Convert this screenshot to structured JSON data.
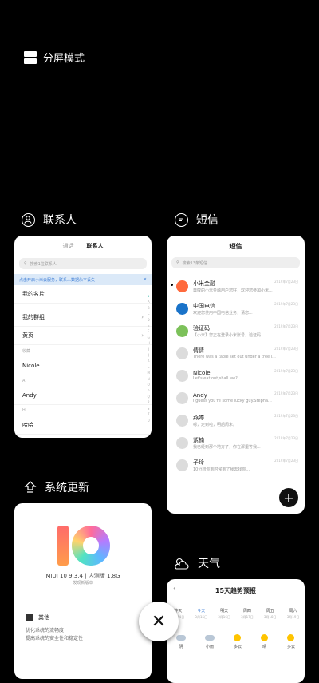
{
  "split_screen": {
    "label": "分屏模式"
  },
  "contacts": {
    "header": "联系人",
    "tabs": [
      {
        "label": "通话"
      },
      {
        "label": "联系人"
      }
    ],
    "search_placeholder": "搜索1位联系人",
    "banner": "点击开启小米云服务，联系人数据永不丢失",
    "rows": [
      {
        "label": "我的名片"
      },
      {
        "label": "我的群组"
      },
      {
        "label": "黄页"
      }
    ],
    "section_labels": [
      "收藏",
      "A",
      "H"
    ],
    "contacts_list": [
      {
        "name": "Nicole"
      },
      {
        "name": "Andy"
      },
      {
        "name": "哈哈"
      }
    ],
    "alpha_index": [
      "★",
      "A",
      "B",
      "C",
      "D",
      "E",
      "F",
      "G",
      "H",
      "I",
      "J",
      "K",
      "L",
      "M",
      "N",
      "O",
      "P",
      "Q",
      "R",
      "S",
      "T",
      "U"
    ]
  },
  "sms": {
    "header": "短信",
    "title": "短信",
    "search_placeholder": "搜索13条短信",
    "messages": [
      {
        "name": "小米金融",
        "preview": "尊敬的小米金融用户您好，欢迎您参加小米...",
        "time": "2019年7月23日",
        "avatar_color": "#ff6a3d",
        "unread": true
      },
      {
        "name": "中国电信",
        "preview": "欢迎您使用中国电信业务，请您...",
        "time": "2019年7月23日",
        "avatar_color": "#1a73c9",
        "unread": false
      },
      {
        "name": "验证码",
        "preview": "【小米】您正在登录小米账号，验证码...",
        "time": "2019年7月23日",
        "avatar_color": "#7cc15a",
        "unread": false
      },
      {
        "name": "倩倩",
        "preview": "There was a table set out under a tree i...",
        "time": "2019年7月23日",
        "avatar_color": "#dcdcdc",
        "unread": false
      },
      {
        "name": "Nicole",
        "preview": "Let's eat out,shall we?",
        "time": "2019年7月23日",
        "avatar_color": "#dcdcdc",
        "unread": false
      },
      {
        "name": "Andy",
        "preview": "I guess you're some lucky guy.Stepha...",
        "time": "2019年7月23日",
        "avatar_color": "#dcdcdc",
        "unread": false
      },
      {
        "name": "燕婷",
        "preview": "嗯，走到啦，明后周末。",
        "time": "2019年7月23日",
        "avatar_color": "#dcdcdc",
        "unread": false
      },
      {
        "name": "紫楠",
        "preview": "我已经到那个地方了，你在那里等我...",
        "time": "2019年7月23日",
        "avatar_color": "#dcdcdc",
        "unread": false
      },
      {
        "name": "子玲",
        "preview": "10分想你到时候到了我去找你...",
        "time": "2019年7月23日",
        "avatar_color": "#dcdcdc",
        "unread": false
      }
    ],
    "fab_label": "+"
  },
  "update": {
    "header": "系统更新",
    "version": "MIUI 10 9.3.4 | 内测版 1.8G",
    "subtitle": "发现新版本",
    "other_label": "其他",
    "desc_line1": "优化系统的流畅度",
    "desc_line2": "提高系统的安全性和稳定性"
  },
  "weather": {
    "header": "天气",
    "title": "15天趋势预报",
    "days": [
      {
        "label": "昨天",
        "date": "3月14日",
        "today": false
      },
      {
        "label": "今天",
        "date": "3月15日",
        "today": true
      },
      {
        "label": "明天",
        "date": "3月16日",
        "today": false
      },
      {
        "label": "周四",
        "date": "3月17日",
        "today": false
      },
      {
        "label": "周五",
        "date": "3月18日",
        "today": false
      },
      {
        "label": "周六",
        "date": "3月19日",
        "today": false
      }
    ],
    "conditions": [
      {
        "label": "阴",
        "icon": "cloud"
      },
      {
        "label": "小雨",
        "icon": "cloud"
      },
      {
        "label": "多云",
        "icon": "sun"
      },
      {
        "label": "晴",
        "icon": "sun"
      },
      {
        "label": "多云",
        "icon": "sun"
      }
    ]
  },
  "close_label": "✕"
}
